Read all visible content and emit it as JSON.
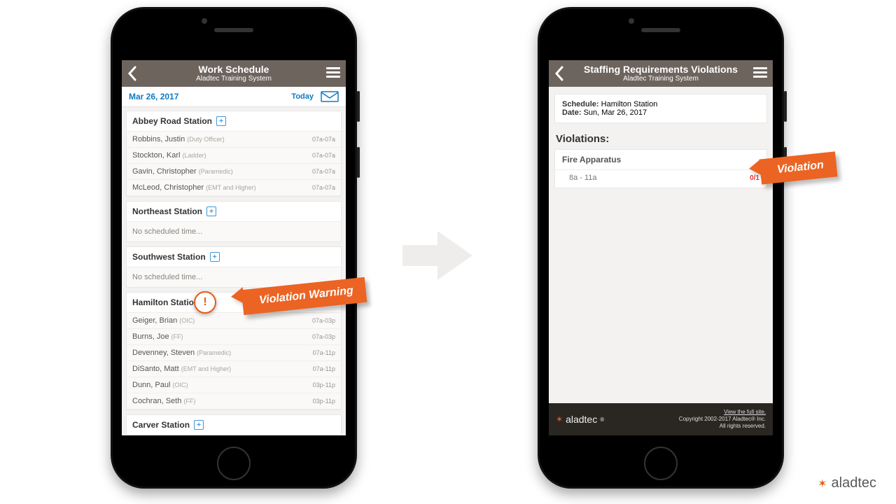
{
  "left": {
    "header": {
      "title": "Work Schedule",
      "sub": "Aladtec Training System"
    },
    "datebar": {
      "date": "Mar 26, 2017",
      "today": "Today"
    },
    "stations": [
      {
        "name": "Abbey Road Station",
        "has_plus": true,
        "rows": [
          {
            "name": "Robbins, Justin",
            "role": "(Duty Officer)",
            "time": "07a-07a"
          },
          {
            "name": "Stockton, Karl",
            "role": "(Ladder)",
            "time": "07a-07a"
          },
          {
            "name": "Gavin, Christopher",
            "role": "(Paramedic)",
            "time": "07a-07a"
          },
          {
            "name": "McLeod, Christopher",
            "role": "(EMT and Higher)",
            "time": "07a-07a"
          }
        ]
      },
      {
        "name": "Northeast Station",
        "has_plus": true,
        "empty": "No scheduled time..."
      },
      {
        "name": "Southwest Station",
        "has_plus": true,
        "empty": "No scheduled time..."
      },
      {
        "name": "Hamilton Station",
        "has_plus": true,
        "violation": true,
        "rows": [
          {
            "name": "Geiger, Brian",
            "role": "(OIC)",
            "time": "07a-03p"
          },
          {
            "name": "Burns, Joe",
            "role": "(FF)",
            "time": "07a-03p"
          },
          {
            "name": "Devenney, Steven",
            "role": "(Paramedic)",
            "time": "07a-11p"
          },
          {
            "name": "DiSanto, Matt",
            "role": "(EMT and Higher)",
            "time": "07a-11p"
          },
          {
            "name": "Dunn, Paul",
            "role": "(OIC)",
            "time": "03p-11p"
          },
          {
            "name": "Cochran, Seth",
            "role": "(FF)",
            "time": "03p-11p"
          }
        ]
      },
      {
        "name": "Carver Station",
        "has_plus": true
      }
    ]
  },
  "right": {
    "header": {
      "title": "Staffing Requirements Violations",
      "sub": "Aladtec Training System"
    },
    "info": {
      "schedule_label": "Schedule:",
      "schedule_value": "Hamilton Station",
      "date_label": "Date:",
      "date_value": "Sun, Mar 26, 2017"
    },
    "violations_title": "Violations:",
    "violation": {
      "group": "Fire Apparatus",
      "range": "8a - 11a",
      "ratio": "0/1"
    },
    "footer": {
      "brand": "aladtec",
      "reg": "®",
      "lines": [
        "View the full site.",
        "Copyright 2002-2017 Aladtec® Inc.",
        "All rights reserved."
      ]
    }
  },
  "callouts": {
    "warning": "Violation Warning",
    "violation": "Violation"
  },
  "brand": {
    "name": "aladtec"
  }
}
